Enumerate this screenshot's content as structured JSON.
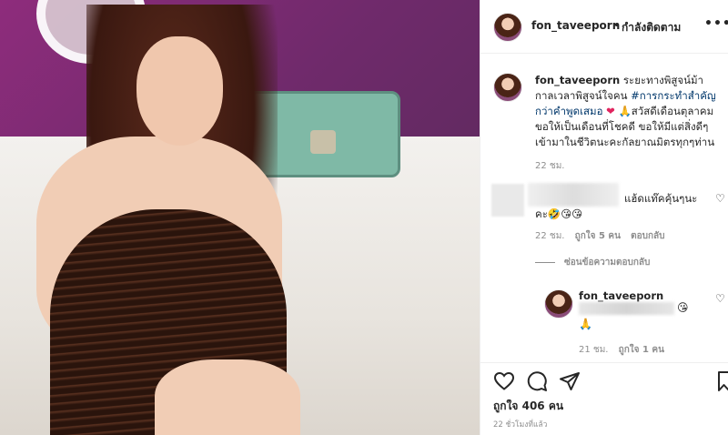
{
  "post": {
    "username": "fon_taveeporn",
    "follow_dot": "•",
    "follow_status": "กำลังติดตาม",
    "more": "•••"
  },
  "caption": {
    "username": "fon_taveeporn",
    "text_before_tag": " ระยะทางพิสูจน์ม้า กาลเวลาพิสูจน์ใจคน ",
    "hashtag": "#การกระทำสำคัญกว่าคำพูดเสมอ",
    "heart": "❤",
    "text_after": " 🙏สวัสดีเดือนตุลาคม ขอให้เป็นเดือนที่โชคดี ขอให้มีแต่สิ่งดีๆเข้ามาในชีวิตนะคะกัลยาณมิตรทุกๆท่าน",
    "time": "22 ชม."
  },
  "comment": {
    "text_line1": "แฮ้ดแท๊คคุ้นๆนะ",
    "text_line2": "คะ🤣😘😘",
    "time": "22 ชม.",
    "likes": "ถูกใจ 5 คน",
    "reply_label": "ตอบกลับ",
    "hide_replies": "ซ่อนข้อความตอบกลับ"
  },
  "reply": {
    "username": "fon_taveeporn",
    "emoji1": "😘",
    "emoji2": "🙏",
    "time": "21 ชม.",
    "likes": "ถูกใจ 1 คน"
  },
  "actions": {
    "like_count": "ถูกใจ 406 คน",
    "posted_ago": "22 ชั่วโมงที่แล้ว"
  },
  "icons": [
    "more-icon",
    "heart-icon",
    "comment-icon",
    "share-icon",
    "bookmark-icon"
  ]
}
